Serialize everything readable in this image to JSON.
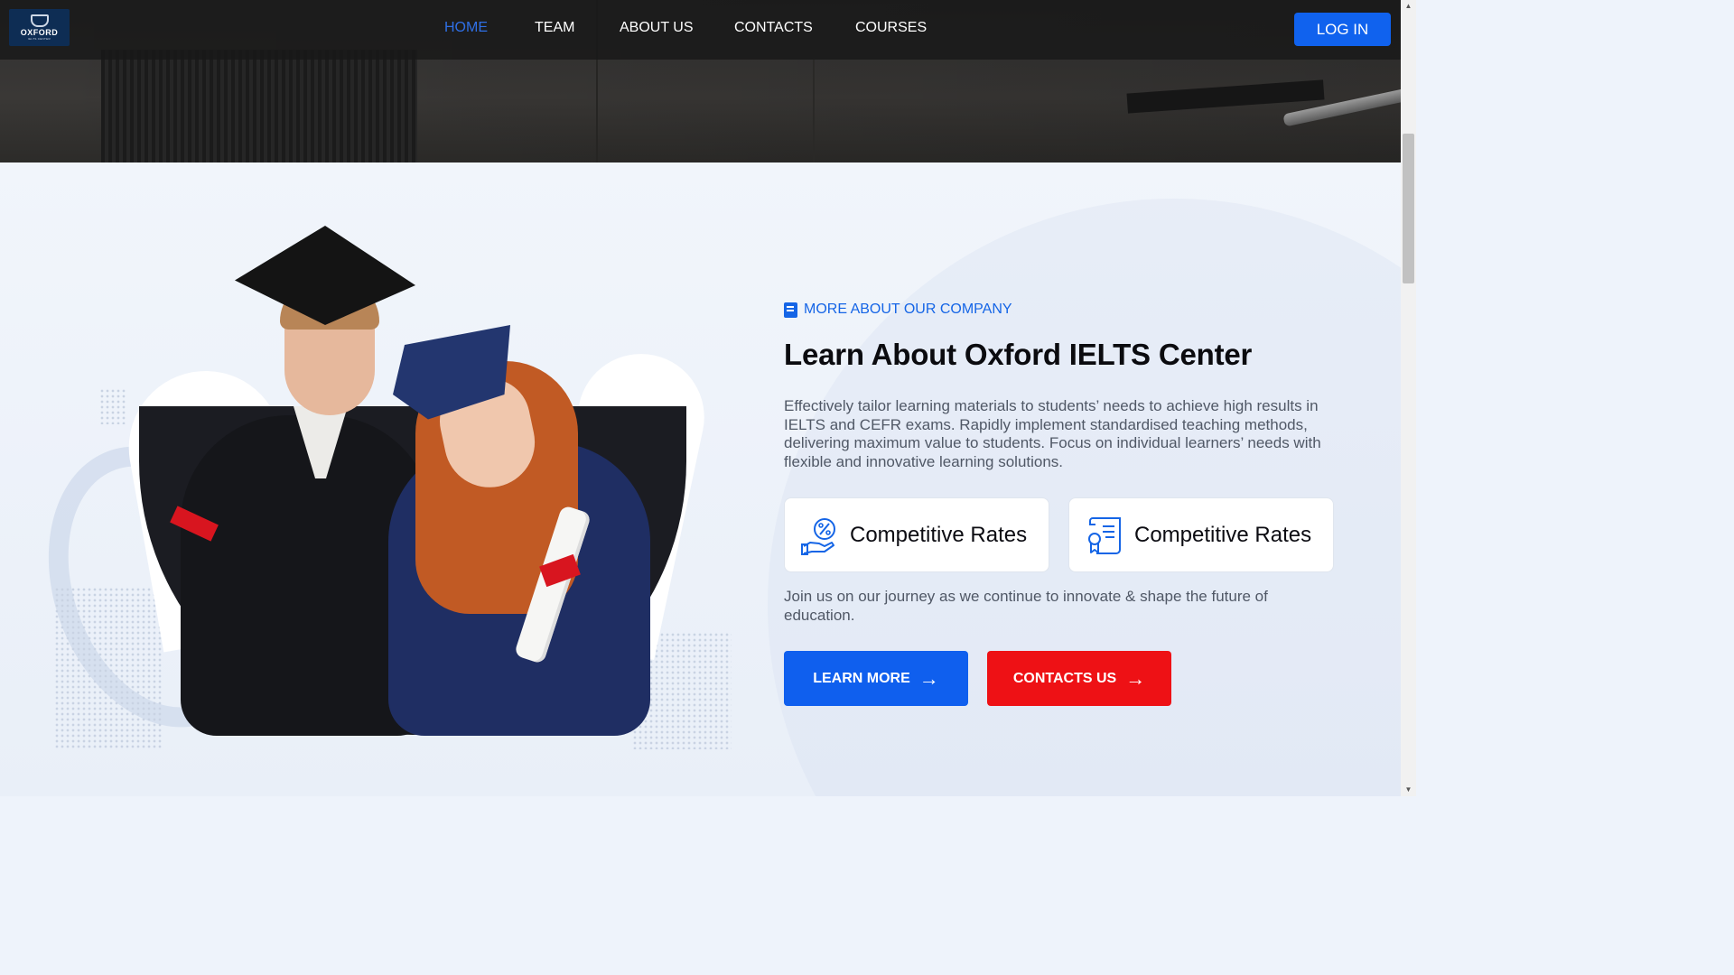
{
  "header": {
    "logo": {
      "brand": "OXFORD",
      "sub": "IELTS CENTER"
    },
    "nav": [
      {
        "label": "HOME",
        "active": true
      },
      {
        "label": "TEAM",
        "active": false
      },
      {
        "label": "ABOUT US",
        "active": false
      },
      {
        "label": "CONTACTS",
        "active": false
      },
      {
        "label": "COURSES",
        "active": false
      }
    ],
    "login_label": "LOG IN"
  },
  "about": {
    "tagline": "MORE ABOUT OUR COMPANY",
    "heading": "Learn About Oxford IELTS Center",
    "description": "Effectively tailor learning materials to students’ needs to achieve high results in IELTS and CEFR exams. Rapidly implement standardised teaching methods, delivering maximum value to students. Focus on individual learners’ needs with flexible and innovative learning solutions.",
    "features": [
      {
        "label": "Competitive Rates",
        "icon": "percent-hand-icon"
      },
      {
        "label": "Competitive Rates",
        "icon": "certificate-icon"
      }
    ],
    "closing": "Join us on our journey as we continue to innovate & shape the future of education.",
    "buttons": {
      "learn_more": "LEARN MORE",
      "contacts": "CONTACTS US"
    }
  },
  "colors": {
    "accent_blue": "#0f5fee",
    "accent_red": "#ee1115",
    "nav_active": "#2f6fe6"
  }
}
